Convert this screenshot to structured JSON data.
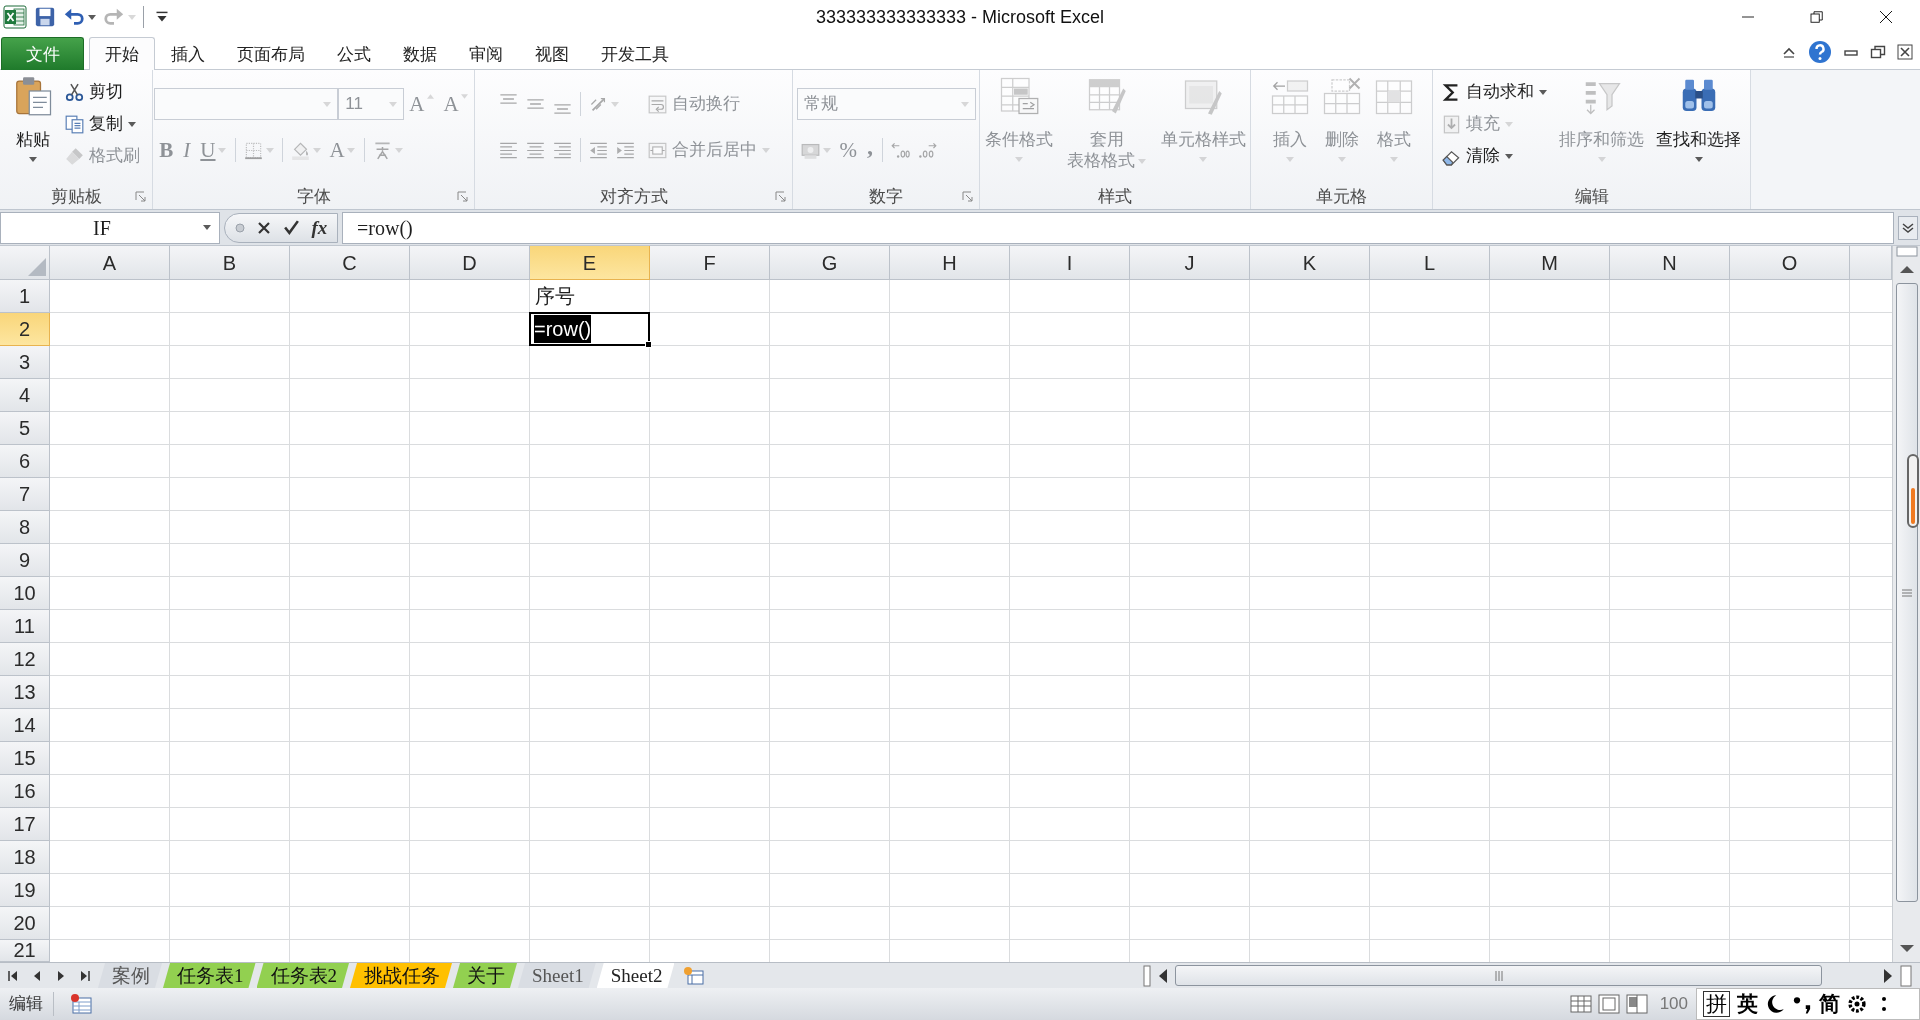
{
  "window": {
    "title": "333333333333333 - Microsoft Excel"
  },
  "quick_access": [
    {
      "disabled": false,
      "dropdown": false
    },
    {
      "disabled": false,
      "dropdown": true
    },
    {
      "disabled": true,
      "dropdown": true
    },
    {
      "disabled": false,
      "dropdown": false
    }
  ],
  "ribbon_tabs": [
    {
      "label": "文件",
      "kind": "file",
      "selected": false
    },
    {
      "label": "开始",
      "kind": "tab",
      "selected": true
    },
    {
      "label": "插入",
      "kind": "tab",
      "selected": false
    },
    {
      "label": "页面布局",
      "kind": "tab",
      "selected": false
    },
    {
      "label": "公式",
      "kind": "tab",
      "selected": false
    },
    {
      "label": "数据",
      "kind": "tab",
      "selected": false
    },
    {
      "label": "审阅",
      "kind": "tab",
      "selected": false
    },
    {
      "label": "视图",
      "kind": "tab",
      "selected": false
    },
    {
      "label": "开发工具",
      "kind": "tab",
      "selected": false
    }
  ],
  "ribbon_groups": [
    {
      "label": "剪贴板",
      "launcher": true,
      "parts": [
        {
          "kind": "large",
          "label": "粘贴",
          "dropdown": true,
          "disabled": false
        },
        {
          "kind": "column",
          "controls": [
            {
              "kind": "small",
              "label": "剪切",
              "dropdown": false,
              "disabled": false
            },
            {
              "kind": "small",
              "label": "复制",
              "dropdown": true,
              "disabled": false
            },
            {
              "kind": "small",
              "label": "格式刷",
              "dropdown": false,
              "disabled": true
            }
          ]
        }
      ]
    },
    {
      "label": "字体",
      "launcher": true,
      "parts": [
        {
          "kind": "rows",
          "rows": [
            [
              {
                "kind": "combo",
                "disabled": true
              },
              {
                "kind": "combo",
                "value": "11",
                "disabled": true
              },
              {
                "kind": "glyph_up",
                "label": "A",
                "dropdown": false,
                "disabled": true
              },
              {
                "kind": "glyph_down",
                "label": "A",
                "dropdown": false,
                "disabled": true
              }
            ],
            [
              {
                "kind": "glyph",
                "label": "B",
                "dropdown": false,
                "disabled": true
              },
              {
                "kind": "glyph",
                "label": "I",
                "dropdown": false,
                "disabled": true
              },
              {
                "kind": "glyph",
                "label": "U",
                "dropdown": true,
                "disabled": true
              },
              {
                "kind": "separator"
              },
              {
                "kind": "icon",
                "dropdown": true,
                "disabled": true
              },
              {
                "kind": "separator"
              },
              {
                "kind": "icon",
                "dropdown": true,
                "disabled": true
              },
              {
                "kind": "glyph",
                "label": "A",
                "dropdown": true,
                "disabled": true
              },
              {
                "kind": "separator"
              },
              {
                "kind": "icon",
                "dropdown": true,
                "disabled": true
              }
            ]
          ]
        }
      ]
    },
    {
      "label": "对齐方式",
      "launcher": true,
      "parts": [
        {
          "kind": "rows",
          "rows": [
            [
              {
                "kind": "icon",
                "dropdown": false,
                "disabled": true
              },
              {
                "kind": "icon",
                "dropdown": false,
                "disabled": true
              },
              {
                "kind": "icon",
                "dropdown": false,
                "disabled": true
              },
              {
                "kind": "separator"
              },
              {
                "kind": "icon",
                "dropdown": true,
                "disabled": true
              }
            ],
            [
              {
                "kind": "icon",
                "dropdown": false,
                "disabled": true
              },
              {
                "kind": "icon",
                "dropdown": false,
                "disabled": true
              },
              {
                "kind": "icon",
                "dropdown": false,
                "disabled": true
              },
              {
                "kind": "separator"
              },
              {
                "kind": "icon",
                "dropdown": false,
                "disabled": true
              },
              {
                "kind": "icon",
                "dropdown": false,
                "disabled": true
              }
            ]
          ]
        },
        {
          "kind": "column",
          "controls": [
            {
              "kind": "small",
              "label": "自动换行",
              "dropdown": false,
              "disabled": true
            },
            {
              "kind": "small",
              "label": "合并后居中",
              "dropdown": true,
              "disabled": true
            }
          ]
        }
      ]
    },
    {
      "label": "数字",
      "launcher": true,
      "parts": [
        {
          "kind": "rows",
          "rows": [
            [
              {
                "kind": "combo",
                "value": "常规",
                "disabled": true
              }
            ],
            [
              {
                "kind": "icon",
                "dropdown": true,
                "disabled": true
              },
              {
                "kind": "glyph",
                "label": "%",
                "dropdown": false,
                "disabled": true
              },
              {
                "kind": "glyph",
                "label": ",",
                "dropdown": false,
                "disabled": true
              },
              {
                "kind": "separator"
              },
              {
                "kind": "icon",
                "dropdown": false,
                "disabled": true
              },
              {
                "kind": "icon",
                "dropdown": false,
                "disabled": true
              }
            ]
          ]
        }
      ]
    },
    {
      "label": "样式",
      "launcher": false,
      "parts": [
        {
          "kind": "large",
          "label": "条件格式",
          "dropdown": true,
          "disabled": true
        },
        {
          "kind": "large_wrapped",
          "label": "套用表格格式",
          "dropdown": true,
          "disabled": true
        },
        {
          "kind": "large",
          "label": "单元格样式",
          "dropdown": true,
          "disabled": true
        }
      ]
    },
    {
      "label": "单元格",
      "launcher": false,
      "parts": [
        {
          "kind": "large",
          "label": "插入",
          "dropdown": true,
          "disabled": true
        },
        {
          "kind": "large",
          "label": "删除",
          "dropdown": true,
          "disabled": true
        },
        {
          "kind": "large",
          "label": "格式",
          "dropdown": true,
          "disabled": true
        }
      ]
    },
    {
      "label": "编辑",
      "launcher": false,
      "parts": [
        {
          "kind": "column",
          "controls": [
            {
              "kind": "small",
              "label": "自动求和",
              "dropdown": true,
              "disabled": false
            },
            {
              "kind": "small",
              "label": "填充",
              "dropdown": true,
              "disabled": true
            },
            {
              "kind": "small",
              "label": "清除",
              "dropdown": true,
              "disabled": false
            }
          ]
        },
        {
          "kind": "large",
          "label": "排序和筛选",
          "dropdown": true,
          "disabled": true
        },
        {
          "kind": "large",
          "label": "查找和选择",
          "dropdown": true,
          "disabled": false
        }
      ]
    }
  ],
  "formula_bar": {
    "name_box": "IF",
    "insert_function": "fx",
    "formula": "=row()"
  },
  "sheet": {
    "columns": [
      {
        "label": "A",
        "selected": false
      },
      {
        "label": "B",
        "selected": false
      },
      {
        "label": "C",
        "selected": false
      },
      {
        "label": "D",
        "selected": false
      },
      {
        "label": "E",
        "selected": true,
        "cells": [
          {
            "value": "序号",
            "selected": false,
            "editing": false
          },
          {
            "value": "=row()",
            "selected": true,
            "editing": true
          }
        ]
      },
      {
        "label": "F",
        "selected": false
      },
      {
        "label": "G",
        "selected": false
      },
      {
        "label": "H",
        "selected": false
      },
      {
        "label": "I",
        "selected": false
      },
      {
        "label": "J",
        "selected": false
      },
      {
        "label": "K",
        "selected": false
      },
      {
        "label": "L",
        "selected": false
      },
      {
        "label": "M",
        "selected": false
      },
      {
        "label": "N",
        "selected": false
      },
      {
        "label": "O",
        "selected": false
      }
    ],
    "rows": [
      {
        "label": "1",
        "selected": false
      },
      {
        "label": "2",
        "selected": true
      },
      {
        "label": "3",
        "selected": false
      },
      {
        "label": "4",
        "selected": false
      },
      {
        "label": "5",
        "selected": false
      },
      {
        "label": "6",
        "selected": false
      },
      {
        "label": "7",
        "selected": false
      },
      {
        "label": "8",
        "selected": false
      },
      {
        "label": "9",
        "selected": false
      },
      {
        "label": "10",
        "selected": false
      },
      {
        "label": "11",
        "selected": false
      },
      {
        "label": "12",
        "selected": false
      },
      {
        "label": "13",
        "selected": false
      },
      {
        "label": "14",
        "selected": false
      },
      {
        "label": "15",
        "selected": false
      },
      {
        "label": "16",
        "selected": false
      },
      {
        "label": "17",
        "selected": false
      },
      {
        "label": "18",
        "selected": false
      },
      {
        "label": "19",
        "selected": false
      },
      {
        "label": "20",
        "selected": false
      },
      {
        "label": "21",
        "selected": false
      }
    ]
  },
  "sheet_tabs": [
    {
      "label": "案例",
      "selected": false
    },
    {
      "label": "任务表1",
      "selected": false,
      "color": "#92d050"
    },
    {
      "label": "任务表2",
      "selected": false,
      "color": "#92d050"
    },
    {
      "label": "挑战任务",
      "selected": false,
      "color": "#ffc000"
    },
    {
      "label": "关于",
      "selected": false,
      "color": "#92d050"
    },
    {
      "label": "Sheet1",
      "selected": false
    },
    {
      "label": "Sheet2",
      "selected": true
    }
  ],
  "status_bar": {
    "mode": "编辑",
    "zoom": "100"
  },
  "ime_toolbar": [
    {
      "kind": "boxed",
      "label": "拼"
    },
    {
      "kind": "text",
      "label": "英"
    },
    {
      "kind": "icon"
    },
    {
      "kind": "icon"
    },
    {
      "kind": "text",
      "label": "简"
    },
    {
      "kind": "icon"
    },
    {
      "kind": "icon"
    }
  ]
}
